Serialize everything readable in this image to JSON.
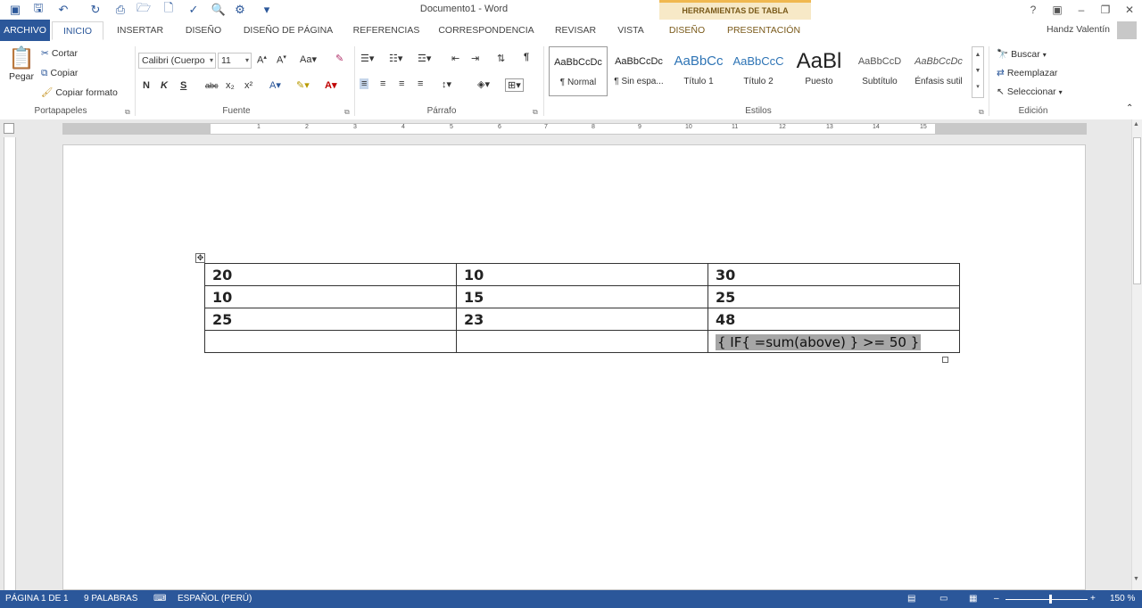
{
  "window": {
    "title": "Documento1 - Word",
    "context_tools": "HERRAMIENTAS DE TABLA",
    "user": "Handz Valentín",
    "help": "?",
    "minimize": "–",
    "restore": "❐",
    "close": "✕"
  },
  "tabs": [
    "ARCHIVO",
    "INICIO",
    "INSERTAR",
    "DISEÑO",
    "DISEÑO DE PÁGINA",
    "REFERENCIAS",
    "CORRESPONDENCIA",
    "REVISAR",
    "VISTA",
    "DISEÑO",
    "PRESENTACIÓN"
  ],
  "ribbon": {
    "clipboard": {
      "label": "Portapapeles",
      "paste": "Pegar",
      "cut": "Cortar",
      "copy": "Copiar",
      "format_painter": "Copiar formato"
    },
    "font": {
      "label": "Fuente",
      "font_name": "Calibri (Cuerpo",
      "font_size": "11",
      "bold": "N",
      "italic": "K",
      "underline": "S",
      "strike": "abc",
      "subscript": "x₂",
      "superscript": "x²"
    },
    "paragraph": {
      "label": "Párrafo"
    },
    "styles": {
      "label": "Estilos",
      "items": [
        {
          "preview": "AaBbCcDc",
          "name": "¶ Normal"
        },
        {
          "preview": "AaBbCcDc",
          "name": "¶ Sin espa..."
        },
        {
          "preview": "AaBbCc",
          "name": "Título 1"
        },
        {
          "preview": "AaBbCcC",
          "name": "Título 2"
        },
        {
          "preview": "AaBl",
          "name": "Puesto"
        },
        {
          "preview": "AaBbCcD",
          "name": "Subtítulo"
        },
        {
          "preview": "AaBbCcDc",
          "name": "Énfasis sutil"
        }
      ]
    },
    "editing": {
      "label": "Edición",
      "find": "Buscar",
      "replace": "Reemplazar",
      "select": "Seleccionar"
    }
  },
  "ruler": [
    "1",
    "2",
    "3",
    "4",
    "5",
    "6",
    "7",
    "8",
    "9",
    "10",
    "11",
    "12",
    "13",
    "14",
    "15"
  ],
  "table": {
    "rows": [
      [
        "20",
        "10",
        "30"
      ],
      [
        "10",
        "15",
        "25"
      ],
      [
        "25",
        "23",
        "48"
      ],
      [
        "",
        "",
        ""
      ]
    ],
    "field_code": "{ IF{ =sum(above) } >= 50 }"
  },
  "status": {
    "page": "PÁGINA 1 DE 1",
    "words": "9 PALABRAS",
    "language": "ESPAÑOL (PERÚ)",
    "zoom": "150 %"
  }
}
